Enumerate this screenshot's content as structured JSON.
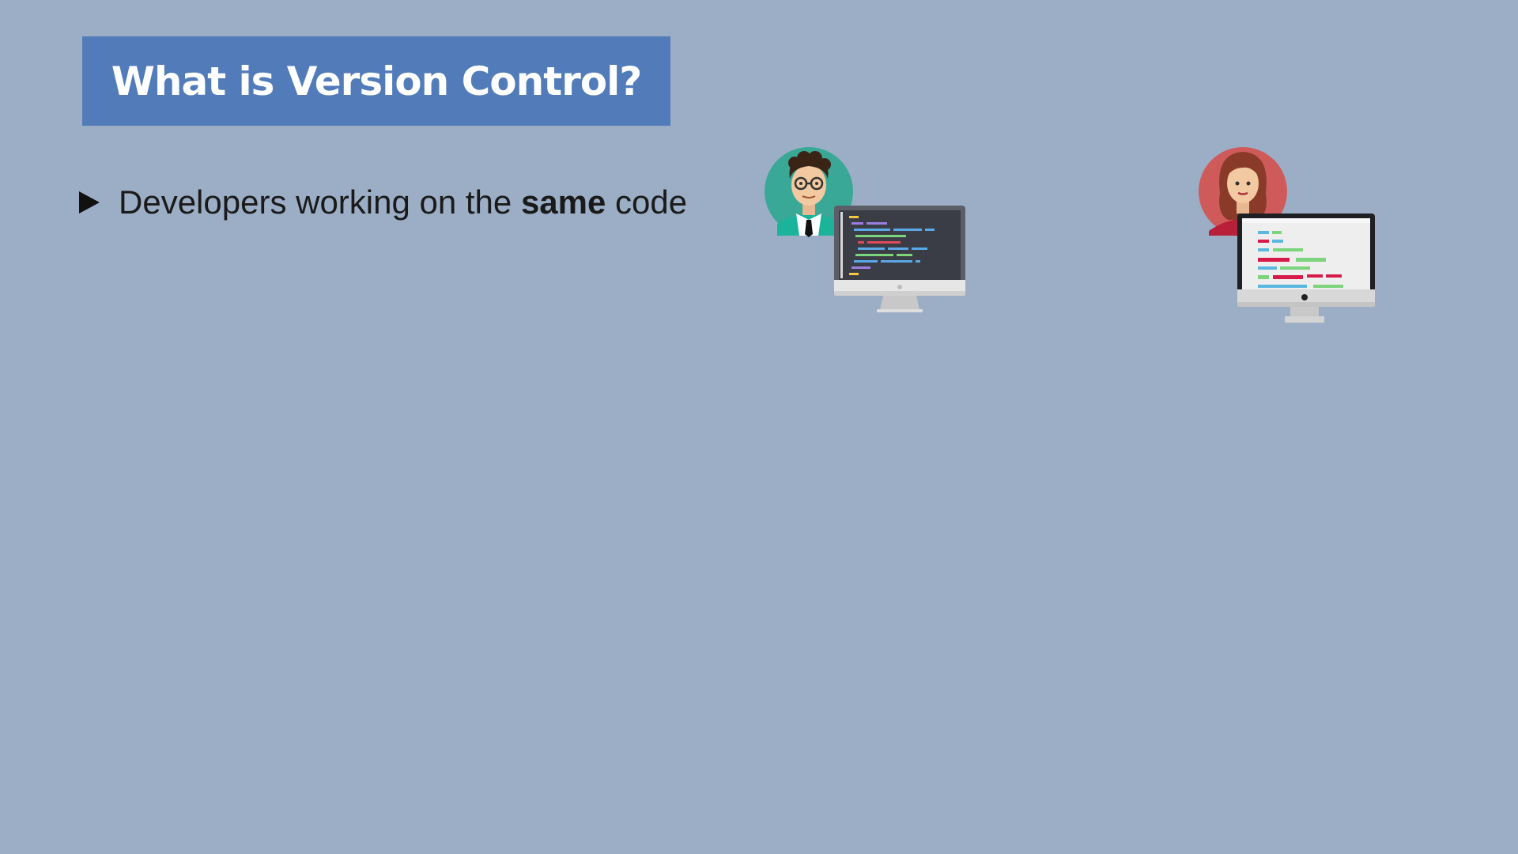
{
  "slide": {
    "title": "What is Version Control?",
    "bullets": [
      {
        "text_before": "Developers working on the ",
        "text_bold": "same",
        "text_after": " code"
      }
    ]
  },
  "illustrations": {
    "developer_1": {
      "icon": "male-developer-icon",
      "monitor_theme": "dark"
    },
    "developer_2": {
      "icon": "female-developer-icon",
      "monitor_theme": "light"
    }
  },
  "colors": {
    "background": "#9caec6",
    "title_bar": "#527cb9",
    "title_text": "#ffffff",
    "bullet_text": "#1a1a1a"
  }
}
